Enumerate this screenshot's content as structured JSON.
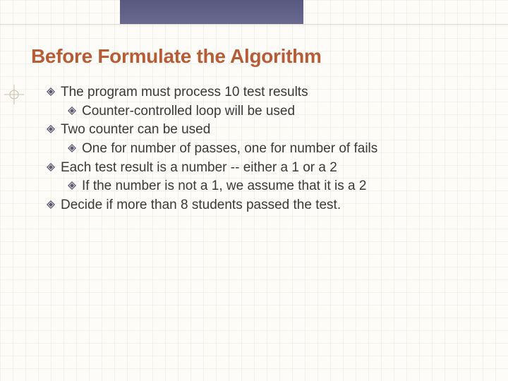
{
  "title": "Before Formulate the Algorithm",
  "bullets": {
    "b1": "The program must process 10 test results",
    "b1a": "Counter-controlled loop will be used",
    "b2": "Two counter can be used",
    "b2a": "One for number of passes, one for number of fails",
    "b3": "Each test result is a number -- either a 1 or a 2",
    "b3a": "If the number is not a 1, we assume that it is a 2",
    "b4": "Decide if more than 8 students passed the test."
  },
  "colors": {
    "title": "#b85c38",
    "band": "#585880",
    "text": "#3a3a3a",
    "bulletFill": "#55557a",
    "bulletEdge": "#f0e0c0"
  }
}
